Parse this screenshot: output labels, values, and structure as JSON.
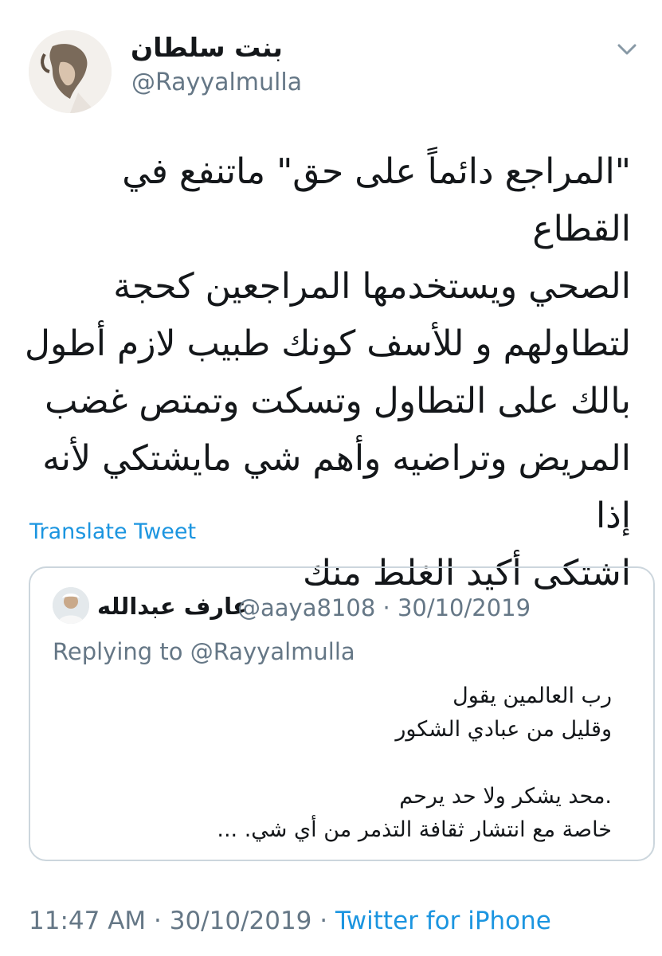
{
  "author": {
    "display_name": "بنت سلطان",
    "handle": "@Rayyalmulla"
  },
  "tweet": {
    "text": "\"المراجع دائماً على حق\" ماتنفع في القطاع\nالصحي ويستخدمها المراجعين كحجة\nلتطاولهم و للأسف كونك طبيب لازم أطول\nبالك على التطاول وتسكت وتمتص غضب\nالمريض وتراضيه وأهم شي مايشتكي لأنه إذا\nاشتكى أكيد الغلط منك",
    "translate_label": "Translate Tweet"
  },
  "quoted": {
    "display_name": "عارف عبدالله",
    "handle": "@aaya8108",
    "separator": "·",
    "date": "30/10/2019",
    "replying_to": "Replying to @Rayyalmulla",
    "lines": [
      "رب العالمين يقول",
      "وقليل من عبادي الشكور",
      "",
      ".محد يشكر ولا حد يرحم",
      "خاصة مع انتشار ثقافة التذمر من أي شي. ..."
    ]
  },
  "footer": {
    "time": "11:47 AM",
    "separator": "·",
    "date": "30/10/2019",
    "source": "Twitter for iPhone"
  },
  "colors": {
    "text": "#14171a",
    "secondary": "#657786",
    "link": "#1b95e0",
    "border": "#ccd6dd"
  },
  "icons": {
    "menu": "chevron-down-icon",
    "avatar": "profile-photo",
    "quoted_avatar": "profile-photo"
  }
}
